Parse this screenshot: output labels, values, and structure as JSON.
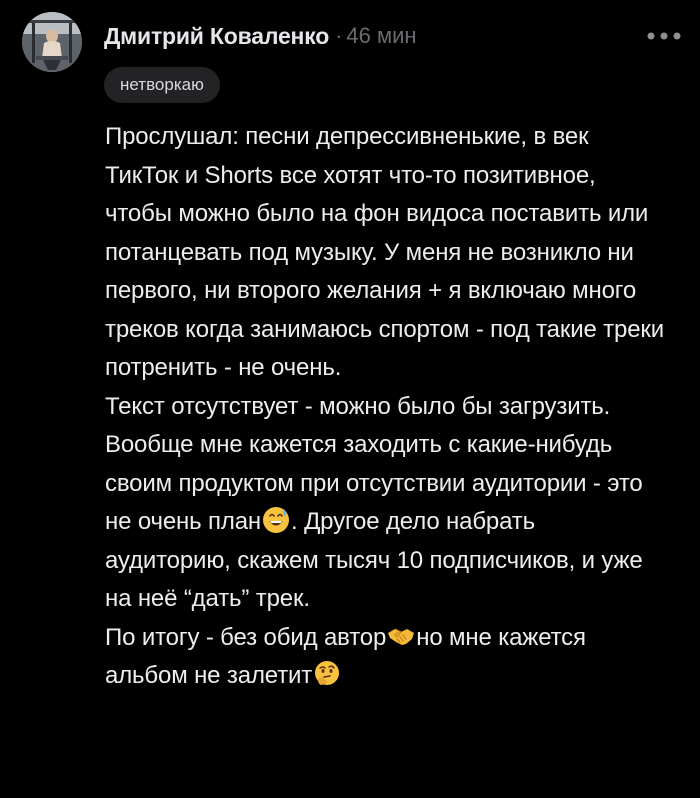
{
  "post": {
    "author_name": "Дмитрий Коваленко",
    "separator": "·",
    "time_ago": "46 мин",
    "tag": "нетворкаю",
    "more_icon": "more-horizontal-icon"
  },
  "comment": {
    "paragraph_1": "Прослушал: песни депрессивненькие, в век ТикТок и Shorts все хотят что-то позитивное, чтобы можно было на фон видоса поставить или потанцевать под музыку. У меня не возникло ни первого, ни второго желания + я включаю много треков когда занимаюсь спортом - под такие треки потренить - не очень.",
    "paragraph_2": "Текст отсутствует - можно было бы загрузить.",
    "paragraph_3_before_emoji": "Вообще мне кажется заходить с какие-нибудь своим продуктом при отсутствии аудитории - это не очень план",
    "paragraph_3_emoji": "grinning-sweat-emoji",
    "paragraph_3_after_emoji": ". Другое дело набрать аудиторию, скажем тысяч 10 подписчиков, и уже на неё “дать” трек.",
    "paragraph_4_before_emoji": "По итогу - без обид автор",
    "paragraph_4_emoji_1": "handshake-emoji",
    "paragraph_4_middle": "но мне кажется альбом не залетит",
    "paragraph_4_emoji_2": "thinking-face-emoji"
  },
  "colors": {
    "background": "#000000",
    "text": "#ededf0",
    "muted": "#6b6b70",
    "chip_bg": "#232326"
  }
}
